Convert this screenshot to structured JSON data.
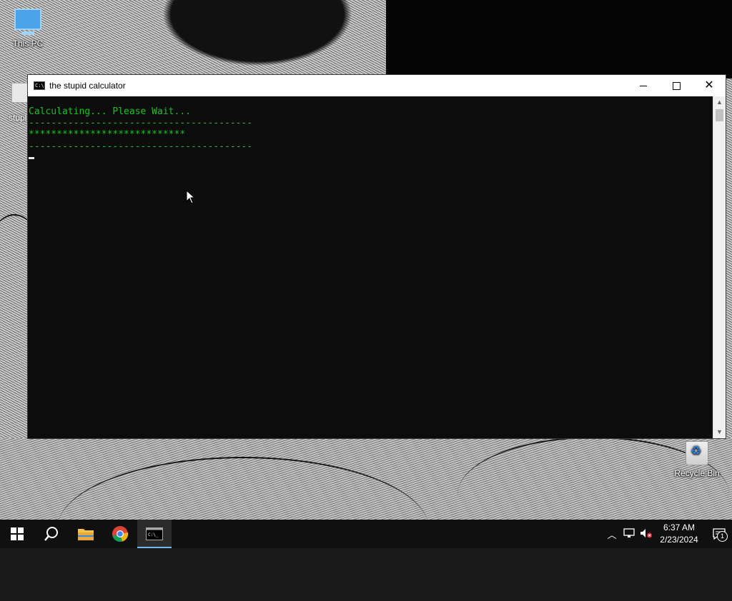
{
  "desktop": {
    "icons": [
      {
        "label": "This PC"
      },
      {
        "label": "stupi"
      },
      {
        "label": "Recycle Bin"
      }
    ]
  },
  "window": {
    "title": "the stupid calculator",
    "console_lines": [
      "Calculating... Please Wait...",
      "----------------------------------------",
      "****************************",
      "----------------------------------------"
    ]
  },
  "taskbar": {
    "time": "6:37 AM",
    "date": "2/23/2024",
    "notification_count": "1"
  },
  "colors": {
    "console_text": "#19c21e",
    "console_bg": "#0c0c0c",
    "taskbar_bg": "#101010",
    "active_accent": "#76b9ed"
  }
}
